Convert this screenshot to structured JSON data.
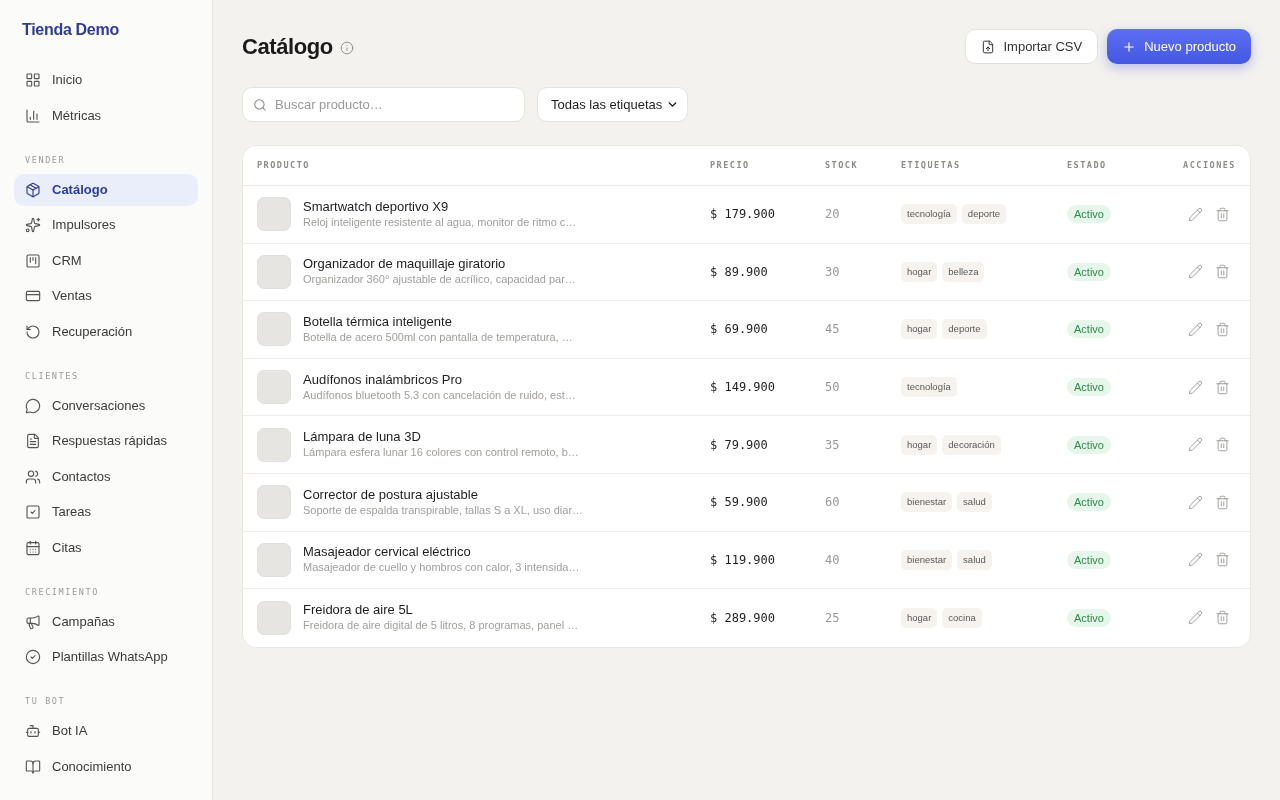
{
  "sidebar": {
    "brand": "Tienda Demo",
    "sections": [
      {
        "items": [
          {
            "label": "Inicio",
            "selected": false
          },
          {
            "label": "Métricas",
            "selected": false
          }
        ]
      },
      {
        "heading": "VENDER",
        "items": [
          {
            "label": "Catálogo",
            "selected": true
          },
          {
            "label": "Impulsores",
            "selected": false
          },
          {
            "label": "CRM",
            "selected": false
          },
          {
            "label": "Ventas",
            "selected": false
          },
          {
            "label": "Recuperación",
            "selected": false
          }
        ]
      },
      {
        "heading": "CLIENTES",
        "items": [
          {
            "label": "Conversaciones",
            "selected": false
          },
          {
            "label": "Respuestas rápidas",
            "selected": false
          },
          {
            "label": "Contactos",
            "selected": false
          },
          {
            "label": "Tareas",
            "selected": false
          },
          {
            "label": "Citas",
            "selected": false
          }
        ]
      },
      {
        "heading": "CRECIMIENTO",
        "items": [
          {
            "label": "Campañas",
            "selected": false
          },
          {
            "label": "Plantillas WhatsApp",
            "selected": false
          }
        ]
      },
      {
        "heading": "TU BOT",
        "items": [
          {
            "label": "Bot IA",
            "selected": false
          },
          {
            "label": "Conocimiento",
            "selected": false
          }
        ]
      }
    ]
  },
  "header": {
    "title": "Catálogo",
    "buttons": [
      {
        "label": "Importar CSV",
        "kind": "secondary"
      },
      {
        "label": "Nuevo producto",
        "kind": "primary"
      }
    ]
  },
  "filters": {
    "search": {
      "placeholder": "Buscar producto…"
    },
    "tag_filter": {
      "value": "Todas las etiquetas"
    }
  },
  "table": {
    "columns": [
      "PRODUCTO",
      "PRECIO",
      "STOCK",
      "ETIQUETAS",
      "ESTADO",
      "ACCIONES"
    ],
    "rows": [
      {
        "name": "Smartwatch deportivo X9",
        "description": "Reloj inteligente resistente al agua, monitor de ritmo c…",
        "price": "$ 179.900",
        "stock": "20",
        "tags": [
          "tecnología",
          "deporte"
        ],
        "status": "Activo"
      },
      {
        "name": "Organizador de maquillaje giratorio",
        "description": "Organizador 360° ajustable de acrílico, capacidad par…",
        "price": "$ 89.900",
        "stock": "30",
        "tags": [
          "hogar",
          "belleza"
        ],
        "status": "Activo"
      },
      {
        "name": "Botella térmica inteligente",
        "description": "Botella de acero 500ml con pantalla de temperatura, …",
        "price": "$ 69.900",
        "stock": "45",
        "tags": [
          "hogar",
          "deporte"
        ],
        "status": "Activo"
      },
      {
        "name": "Audífonos inalámbricos Pro",
        "description": "Audífonos bluetooth 5.3 con cancelación de ruido, est…",
        "price": "$ 149.900",
        "stock": "50",
        "tags": [
          "tecnología"
        ],
        "status": "Activo"
      },
      {
        "name": "Lámpara de luna 3D",
        "description": "Lámpara esfera lunar 16 colores con control remoto, b…",
        "price": "$ 79.900",
        "stock": "35",
        "tags": [
          "hogar",
          "decoración"
        ],
        "status": "Activo"
      },
      {
        "name": "Corrector de postura ajustable",
        "description": "Soporte de espalda transpirable, tallas S a XL, uso diar…",
        "price": "$ 59.900",
        "stock": "60",
        "tags": [
          "bienestar",
          "salud"
        ],
        "status": "Activo"
      },
      {
        "name": "Masajeador cervical eléctrico",
        "description": "Masajeador de cuello y hombros con calor, 3 intensida…",
        "price": "$ 119.900",
        "stock": "40",
        "tags": [
          "bienestar",
          "salud"
        ],
        "status": "Activo"
      },
      {
        "name": "Freidora de aire 5L",
        "description": "Freidora de aire digital de 5 litros, 8 programas, panel …",
        "price": "$ 289.900",
        "stock": "25",
        "tags": [
          "hogar",
          "cocina"
        ],
        "status": "Activo"
      }
    ]
  }
}
